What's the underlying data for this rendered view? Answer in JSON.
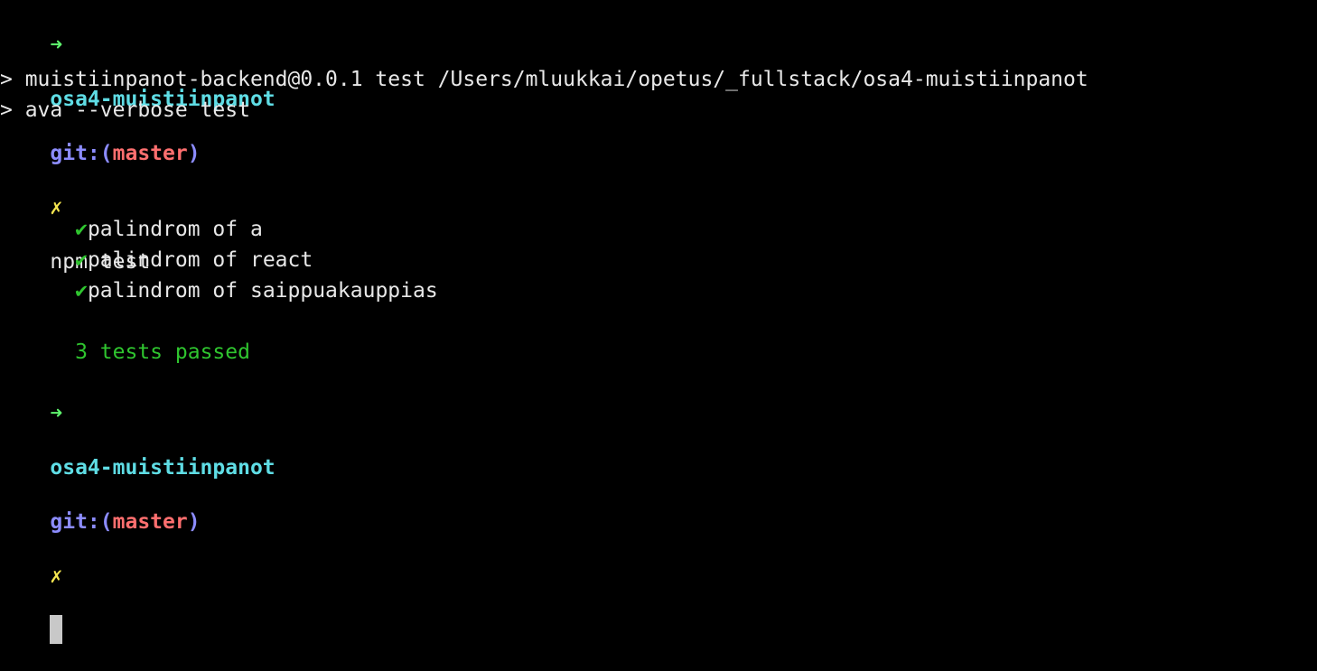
{
  "theme": {
    "background": "#000000",
    "text": "#e8e8e8",
    "arrow": "#5ff46e",
    "directory": "#5fdde5",
    "git": "#8c8cff",
    "branch": "#ff6f6f",
    "dirty": "#f5e64f",
    "success": "#2fc52f"
  },
  "prompt1": {
    "arrow": "➜",
    "directory": "osa4-muistiinpanot",
    "git_label": "git:(",
    "branch": "master",
    "git_close": ")",
    "dirty_mark": "✗",
    "command": "npm test"
  },
  "npm_output": {
    "line1": "> muistiinpanot-backend@0.0.1 test /Users/mluukkai/opetus/_fullstack/osa4-muistiinpanot",
    "line2": "> ava --verbose test"
  },
  "tests": [
    {
      "icon": "check-icon",
      "mark": "✔",
      "name": "palindrom of a"
    },
    {
      "icon": "check-icon",
      "mark": "✔",
      "name": "palindrom of react"
    },
    {
      "icon": "check-icon",
      "mark": "✔",
      "name": "palindrom of saippuakauppias"
    }
  ],
  "summary": "3 tests passed",
  "prompt2": {
    "arrow": "➜",
    "directory": "osa4-muistiinpanot",
    "git_label": "git:(",
    "branch": "master",
    "git_close": ")",
    "dirty_mark": "✗"
  }
}
